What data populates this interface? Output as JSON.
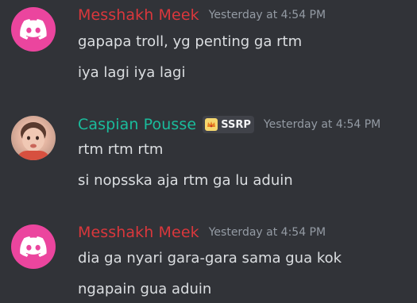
{
  "messages": [
    {
      "author": "Messhakh Meek",
      "author_color": "#da373c",
      "avatar": "discord-default-avatar",
      "timestamp": "Yesterday at 4:54 PM",
      "lines": [
        "gapapa troll, yg penting ga rtm",
        "iya lagi iya lagi"
      ]
    },
    {
      "author": "Caspian Pousse",
      "author_color": "#1abc9c",
      "avatar": "user-photo-avatar",
      "tag": "SSRP",
      "tag_icon": "crown-badge-icon",
      "timestamp": "Yesterday at 4:54 PM",
      "lines": [
        "rtm rtm rtm",
        "si nopsska aja rtm ga lu aduin"
      ]
    },
    {
      "author": "Messhakh Meek",
      "author_color": "#da373c",
      "avatar": "discord-default-avatar",
      "timestamp": "Yesterday at 4:54 PM",
      "lines": [
        "dia ga nyari gara-gara sama gua kok",
        "ngapain gua aduin"
      ]
    }
  ]
}
